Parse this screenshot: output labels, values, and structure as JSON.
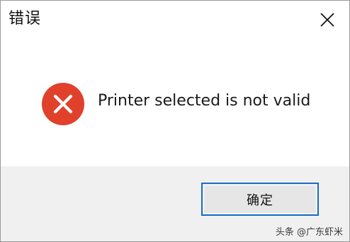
{
  "dialog": {
    "title": "错误",
    "message": "Printer selected is not valid",
    "ok_label": "确定",
    "icon": "error-icon",
    "close_icon": "close-icon"
  },
  "watermark": {
    "text": "头条 @广东虾米"
  },
  "colors": {
    "error_red": "#e1402b",
    "button_border": "#1a6dc8",
    "footer_bg": "#f0f0f0"
  }
}
